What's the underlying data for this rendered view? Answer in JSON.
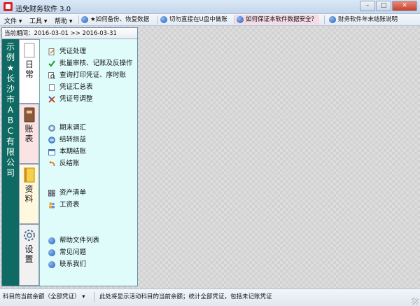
{
  "window": {
    "title": "迅免财务软件 3.0",
    "min": "–",
    "max": "□",
    "close": "✕"
  },
  "menu": {
    "file": "文件 ▾",
    "tools": "工具 ▾",
    "help": "帮助 ▾"
  },
  "shortcuts": [
    "★如何备份、恢复数据",
    "切勿直接在U盘中做账",
    "如何保证本软件数据安全？",
    "财务软件年末结账说明"
  ],
  "period": {
    "label": "当前期间：2016-03-01 >> 2016-03-31"
  },
  "company": {
    "name": [
      "示",
      "例",
      "★",
      "长",
      "沙",
      "市",
      "A",
      "B",
      "C",
      "有",
      "限",
      "公",
      "司"
    ]
  },
  "tabs": [
    {
      "label": "日常",
      "icon": "blank-page-icon"
    },
    {
      "label": "账表",
      "icon": "ledger-book-icon"
    },
    {
      "label": "资料",
      "icon": "notebook-icon"
    },
    {
      "label": "设置",
      "icon": "gear-icon"
    }
  ],
  "items": {
    "voucher_process": "凭证处理",
    "batch_audit": "批量审核、记账及反操作",
    "query_print": "查询打印凭证、序时账",
    "voucher_summary": "凭证汇总表",
    "voucher_renumber": "凭证号调整",
    "period_end_adjust": "期末调汇",
    "carry_profit_loss": "结转损益",
    "close_period": "本期结账",
    "reverse_close": "反结账",
    "asset_list": "资产清单",
    "payroll": "工资表",
    "help_files": "帮助文件列表",
    "faq": "常见问题",
    "contact_us": "联系我们"
  },
  "status": {
    "left": "科目的当前余额（全部凭证）  ▾",
    "right": "此处将显示活动科目的当前余额；统计全部凭证，包括未记账凭证"
  },
  "colors": {
    "sidebar_green": "#0e6a62",
    "content_bg": "#dffcfb",
    "highlight": "#f6dbe4"
  }
}
